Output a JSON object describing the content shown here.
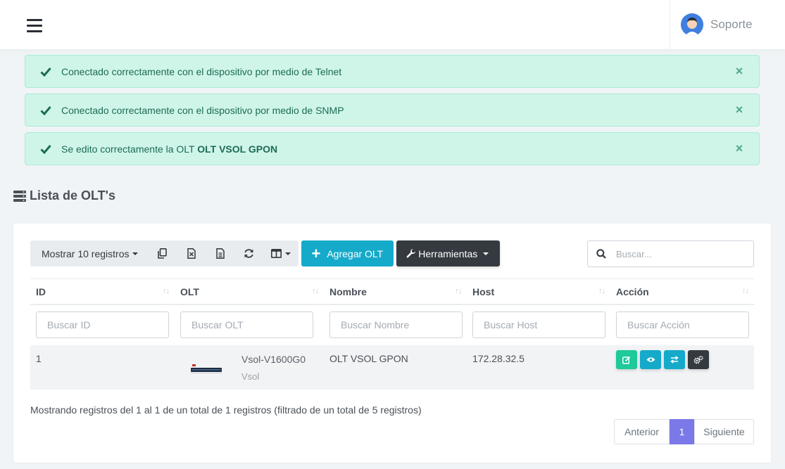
{
  "header": {
    "user_name": "Soporte"
  },
  "alerts": [
    {
      "text": "Conectado correctamente con el dispositivo por medio de Telnet",
      "close": "×"
    },
    {
      "text": "Conectado correctamente con el dispositivo por medio de SNMP",
      "close": "×"
    },
    {
      "text_prefix": "Se edito correctamente la OLT ",
      "text_bold": "OLT VSOL GPON",
      "close": "×"
    }
  ],
  "section": {
    "title": "Lista de OLT's"
  },
  "toolbar": {
    "length_label": "Mostrar 10 registros",
    "add_label": "Agregar OLT",
    "add_icon": "+",
    "tools_label": "Herramientas"
  },
  "search": {
    "placeholder": "Buscar..."
  },
  "table": {
    "columns": [
      "ID",
      "OLT",
      "Nombre",
      "Host",
      "Acción"
    ],
    "sort_glyph": "↑↓",
    "filters": [
      "Buscar ID",
      "Buscar OLT",
      "Buscar Nombre",
      "Buscar Host",
      "Buscar Acción"
    ],
    "rows": [
      {
        "id": "1",
        "olt_model": "Vsol-V1600G0",
        "olt_brand": "Vsol",
        "nombre": "OLT VSOL GPON",
        "host": "172.28.32.5"
      }
    ]
  },
  "footer": {
    "info": "Mostrando registros del 1 al 1 de un total de 1 registros (filtrado de un total de 5 registros)",
    "prev": "Anterior",
    "page": "1",
    "next": "Siguiente"
  },
  "colors": {
    "alert_bg": "#cff5e9",
    "btn_add": "#16aaca",
    "btn_tools": "#343a40",
    "act_edit": "#1ec99a",
    "act_view": "#16aaca",
    "act_transfer": "#16aaca",
    "act_config": "#343a40",
    "page_active": "#7b79e8"
  },
  "icons": [
    "menu-icon",
    "avatar",
    "check-icon",
    "close-icon",
    "server-icon",
    "copy-icon",
    "excel-icon",
    "csv-icon",
    "refresh-icon",
    "columns-icon",
    "plus-icon",
    "wrench-icon",
    "search-icon",
    "edit-icon",
    "eye-icon",
    "exchange-icon",
    "cogs-icon"
  ]
}
